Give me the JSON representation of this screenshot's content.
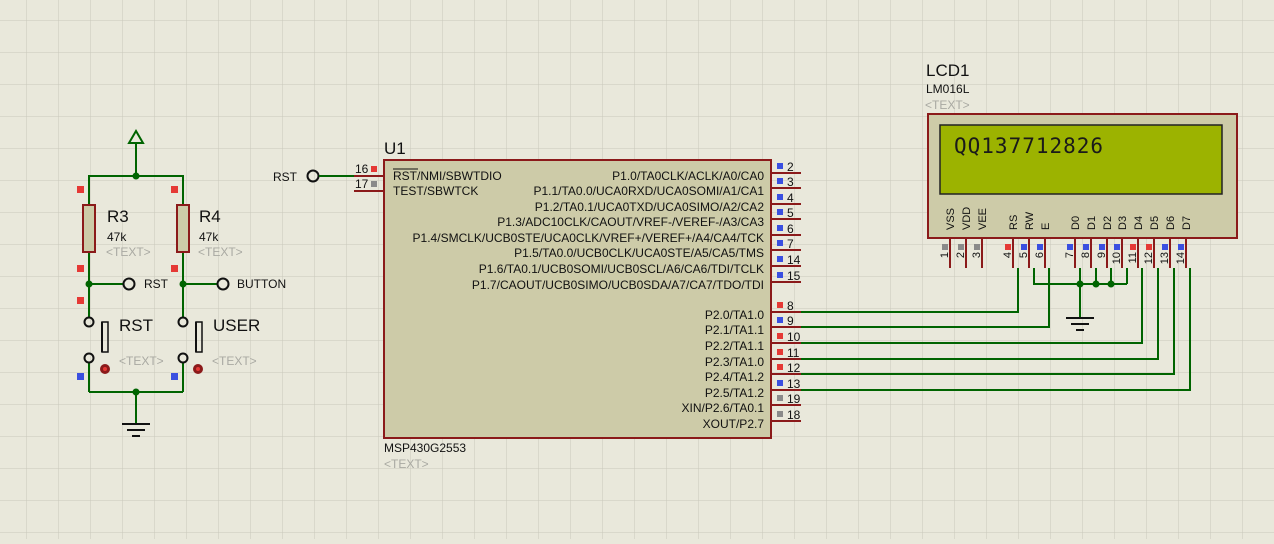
{
  "colors": {
    "background": "#e9e8db",
    "grid": "#c9c8bb",
    "wire": "#006400",
    "component_body": "#cdcba8",
    "component_border": "#8b1a1a",
    "lcd_screen": "#9cb300",
    "pin_red": "#e53935",
    "pin_blue": "#3a4fe0",
    "pin_gray": "#8a8a8a"
  },
  "resistors": [
    {
      "ref": "R3",
      "value": "47k",
      "text": "<TEXT>"
    },
    {
      "ref": "R4",
      "value": "47k",
      "text": "<TEXT>"
    }
  ],
  "buttons": [
    {
      "ref": "RST",
      "text": "<TEXT>"
    },
    {
      "ref": "USER",
      "text": "<TEXT>"
    }
  ],
  "terminals": {
    "rst_left": "RST",
    "rst_mid": "RST",
    "button": "BUTTON"
  },
  "mcu": {
    "ref": "U1",
    "part": "MSP430G2553",
    "text": "<TEXT>",
    "left_pins": [
      {
        "num": "16",
        "name": "RST/NMI/SBWTDIO"
      },
      {
        "num": "17",
        "name": "TEST/SBWTCK"
      }
    ],
    "right_pins": [
      {
        "num": "2",
        "name": "P1.0/TA0CLK/ACLK/A0/CA0"
      },
      {
        "num": "3",
        "name": "P1.1/TA0.0/UCA0RXD/UCA0SOMI/A1/CA1"
      },
      {
        "num": "4",
        "name": "P1.2/TA0.1/UCA0TXD/UCA0SIMO/A2/CA2"
      },
      {
        "num": "5",
        "name": "P1.3/ADC10CLK/CAOUT/VREF-/VEREF-/A3/CA3"
      },
      {
        "num": "6",
        "name": "P1.4/SMCLK/UCB0STE/UCA0CLK/VREF+/VEREF+/A4/CA4/TCK"
      },
      {
        "num": "7",
        "name": "P1.5/TA0.0/UCB0CLK/UCA0STE/A5/CA5/TMS"
      },
      {
        "num": "14",
        "name": "P1.6/TA0.1/UCB0SOMI/UCB0SCL/A6/CA6/TDI/TCLK"
      },
      {
        "num": "15",
        "name": "P1.7/CAOUT/UCB0SIMO/UCB0SDA/A7/CA7/TDO/TDI"
      },
      {
        "num": "8",
        "name": "P2.0/TA1.0"
      },
      {
        "num": "9",
        "name": "P2.1/TA1.1"
      },
      {
        "num": "10",
        "name": "P2.2/TA1.1"
      },
      {
        "num": "11",
        "name": "P2.3/TA1.0"
      },
      {
        "num": "12",
        "name": "P2.4/TA1.2"
      },
      {
        "num": "13",
        "name": "P2.5/TA1.2"
      },
      {
        "num": "19",
        "name": "XIN/P2.6/TA0.1"
      },
      {
        "num": "18",
        "name": "XOUT/P2.7"
      }
    ]
  },
  "lcd": {
    "ref": "LCD1",
    "part": "LM016L",
    "text": "<TEXT>",
    "display": "QQ137712826",
    "pins": [
      {
        "num": "1",
        "name": "VSS"
      },
      {
        "num": "2",
        "name": "VDD"
      },
      {
        "num": "3",
        "name": "VEE"
      },
      {
        "num": "4",
        "name": "RS"
      },
      {
        "num": "5",
        "name": "RW"
      },
      {
        "num": "6",
        "name": "E"
      },
      {
        "num": "7",
        "name": "D0"
      },
      {
        "num": "8",
        "name": "D1"
      },
      {
        "num": "9",
        "name": "D2"
      },
      {
        "num": "10",
        "name": "D3"
      },
      {
        "num": "11",
        "name": "D4"
      },
      {
        "num": "12",
        "name": "D5"
      },
      {
        "num": "13",
        "name": "D6"
      },
      {
        "num": "14",
        "name": "D7"
      }
    ]
  }
}
